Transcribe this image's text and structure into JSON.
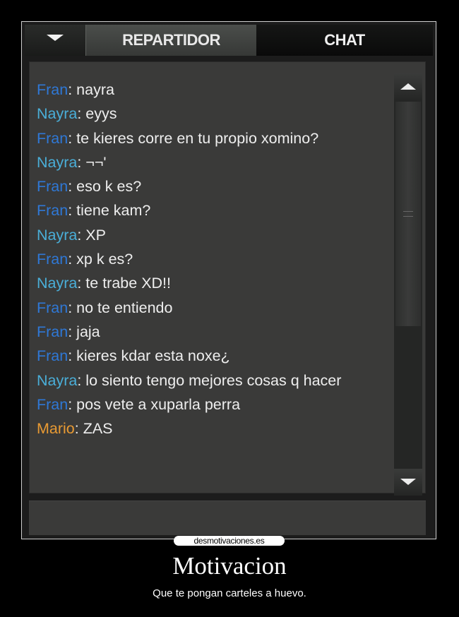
{
  "app": {
    "tabs": {
      "repartidor": "REPARTIDOR",
      "chat": "CHAT"
    }
  },
  "colors": {
    "fran": "#2f78d6",
    "nayra": "#4aaed8",
    "mario": "#e89a33",
    "text": "#eeeeee"
  },
  "messages": [
    {
      "sender": "Fran",
      "text": ": nayra",
      "color": "#2f78d6"
    },
    {
      "sender": "Nayra",
      "text": ": eyys",
      "color": "#4aaed8"
    },
    {
      "sender": "Fran",
      "text": ": te kieres corre en tu propio xomino?",
      "color": "#2f78d6"
    },
    {
      "sender": "Nayra",
      "text": ": ¬¬'",
      "color": "#4aaed8"
    },
    {
      "sender": "Fran",
      "text": ": eso k es?",
      "color": "#2f78d6"
    },
    {
      "sender": "Fran",
      "text": ": tiene kam?",
      "color": "#2f78d6"
    },
    {
      "sender": "Nayra",
      "text": ": XP",
      "color": "#4aaed8"
    },
    {
      "sender": "Fran",
      "text": ": xp k es?",
      "color": "#2f78d6"
    },
    {
      "sender": "Nayra",
      "text": ": te trabe XD!!",
      "color": "#4aaed8"
    },
    {
      "sender": "Fran",
      "text": ": no te entiendo",
      "color": "#2f78d6"
    },
    {
      "sender": "Fran",
      "text": ": jaja",
      "color": "#2f78d6"
    },
    {
      "sender": "Fran",
      "text": ": kieres kdar esta noxe¿",
      "color": "#2f78d6"
    },
    {
      "sender": "Nayra",
      "text": ": lo siento tengo mejores cosas q hacer",
      "color": "#4aaed8"
    },
    {
      "sender": "Fran",
      "text": ": pos vete a xuparla perra",
      "color": "#2f78d6"
    },
    {
      "sender": "Mario",
      "text": ": ZAS",
      "color": "#e89a33"
    }
  ],
  "footer": {
    "logo_text": "desmotivaciones.es",
    "title": "Motivacion",
    "subtitle": "Que te pongan carteles a huevo."
  }
}
